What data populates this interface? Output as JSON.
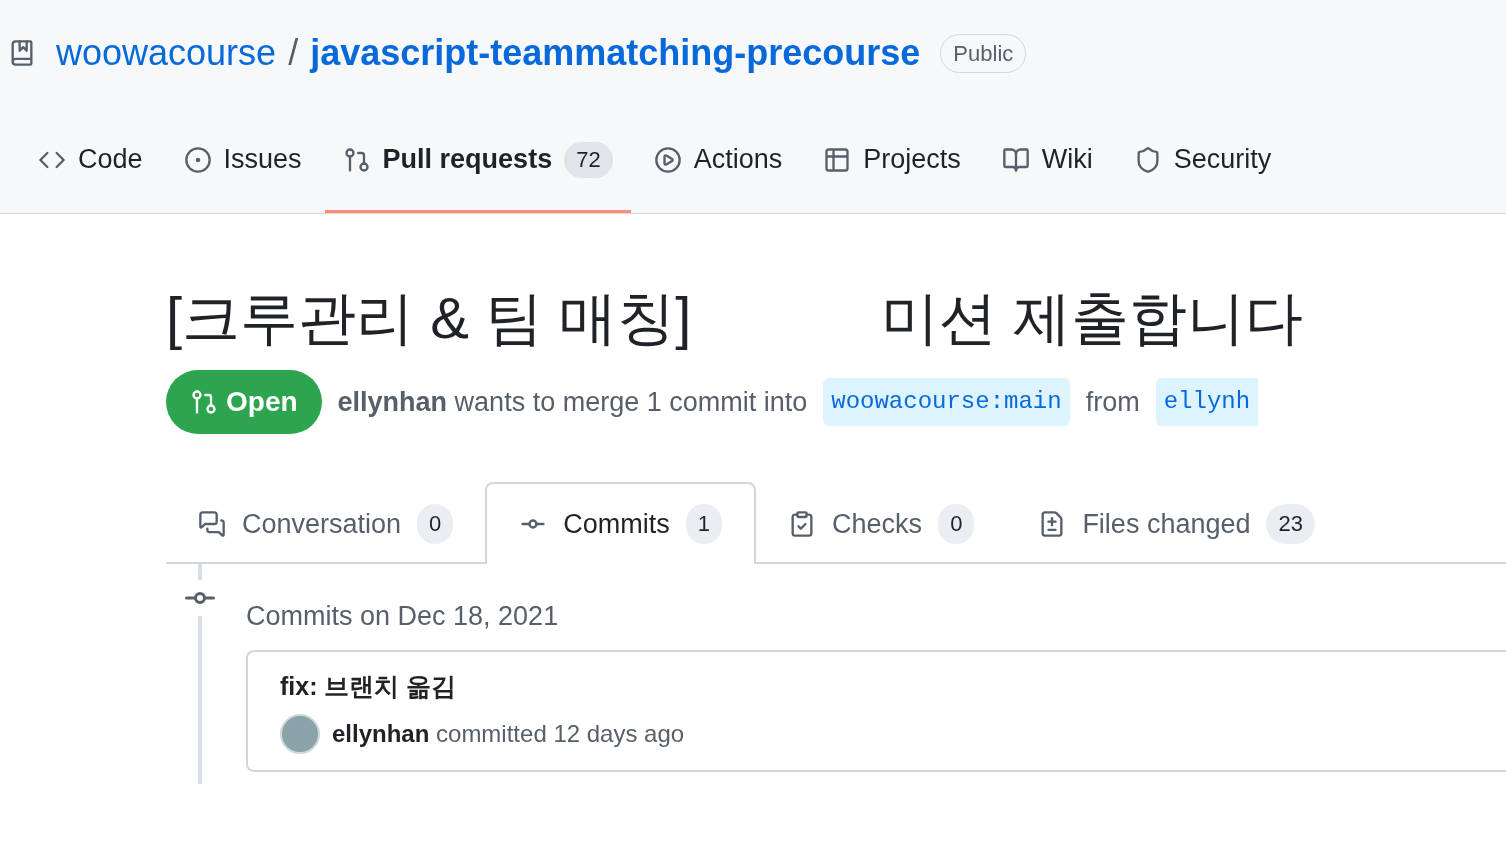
{
  "repo": {
    "owner": "woowacourse",
    "separator": "/",
    "name": "javascript-teammatching-precourse",
    "visibility": "Public"
  },
  "repo_tabs": [
    {
      "kind": "code",
      "label": "Code",
      "selected": false
    },
    {
      "kind": "issues",
      "label": "Issues",
      "selected": false
    },
    {
      "kind": "pulls",
      "label": "Pull requests",
      "count": "72",
      "selected": true
    },
    {
      "kind": "actions",
      "label": "Actions",
      "selected": false
    },
    {
      "kind": "projects",
      "label": "Projects",
      "selected": false
    },
    {
      "kind": "wiki",
      "label": "Wiki",
      "selected": false
    },
    {
      "kind": "security",
      "label": "Security",
      "selected": false
    }
  ],
  "pull_request": {
    "title_parts": [
      "[크루관리 & 팀 매칭]",
      "미션 제출합니다"
    ],
    "state": "Open",
    "summary": "**ellynhan** wants to merge 1 commit into",
    "base_branch": "woowacourse:main",
    "from_word": "from",
    "head_branch": "ellynh"
  },
  "pr_tabs": [
    {
      "kind": "conversation",
      "label": "Conversation",
      "count": "0",
      "selected": false
    },
    {
      "kind": "commits",
      "label": "Commits",
      "count": "1",
      "selected": true
    },
    {
      "kind": "checks",
      "label": "Checks",
      "count": "0",
      "selected": false
    },
    {
      "kind": "files",
      "label": "Files changed",
      "count": "23",
      "selected": false
    }
  ],
  "commit_groups": [
    {
      "heading": "Commits on Dec 18, 2021",
      "commits": [
        {
          "message": "fix: 브랜치 옮김",
          "byline": "**ellynhan** committed 12 days ago"
        }
      ]
    }
  ]
}
